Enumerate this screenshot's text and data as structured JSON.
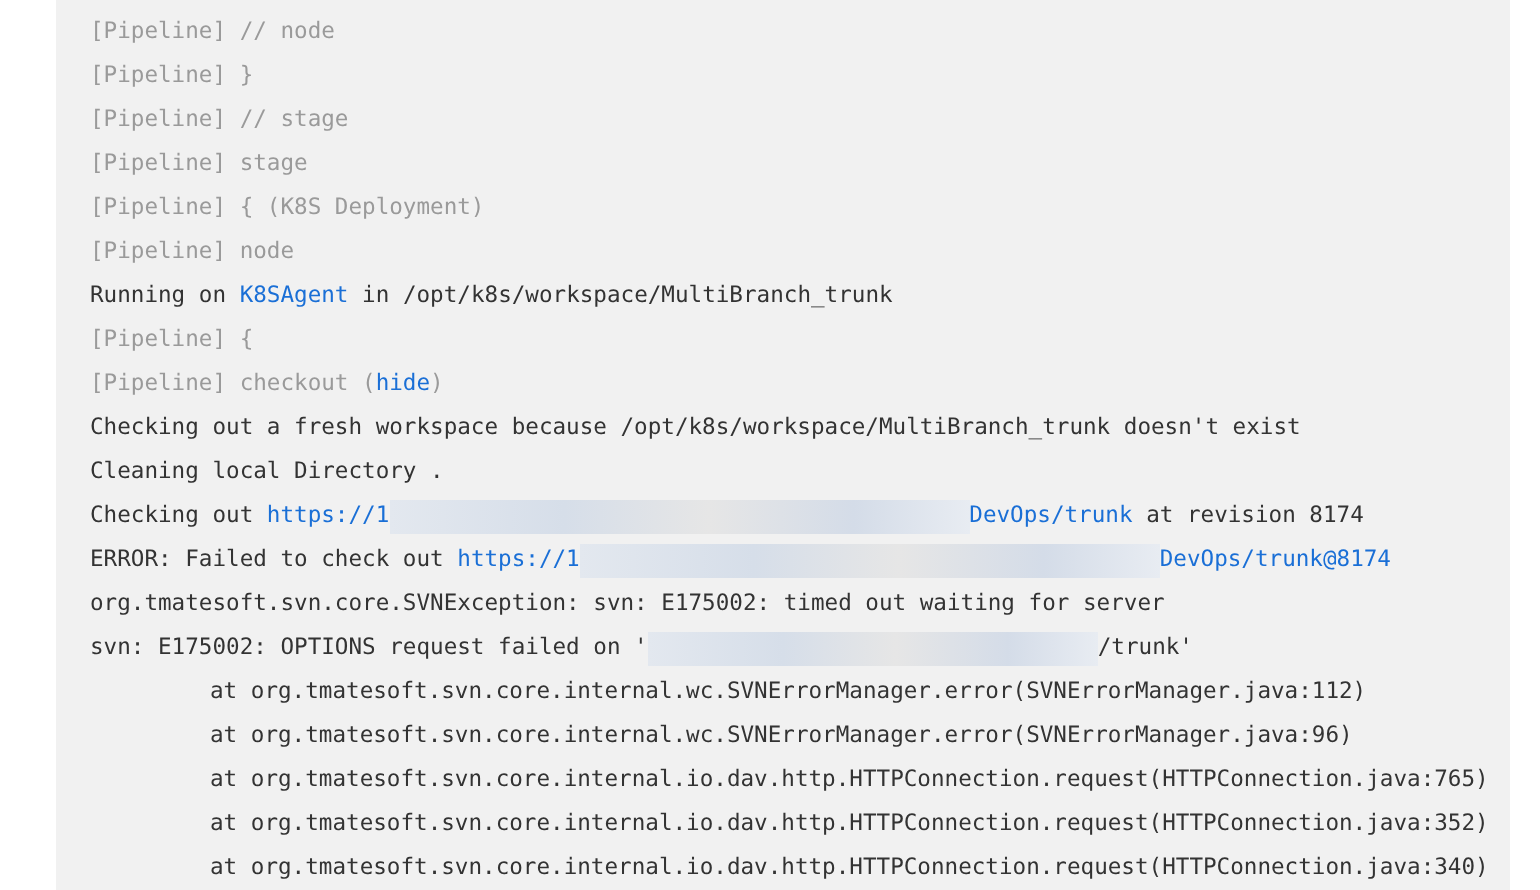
{
  "console_lines": [
    {
      "segments": [
        {
          "kind": "gray",
          "text": "[Pipeline] // node"
        }
      ]
    },
    {
      "segments": [
        {
          "kind": "gray",
          "text": "[Pipeline] }"
        }
      ]
    },
    {
      "segments": [
        {
          "kind": "gray",
          "text": "[Pipeline] // stage"
        }
      ]
    },
    {
      "segments": [
        {
          "kind": "gray",
          "text": "[Pipeline] stage"
        }
      ]
    },
    {
      "segments": [
        {
          "kind": "gray",
          "text": "[Pipeline] { (K8S Deployment)"
        }
      ]
    },
    {
      "segments": [
        {
          "kind": "gray",
          "text": "[Pipeline] node"
        }
      ]
    },
    {
      "segments": [
        {
          "kind": "text",
          "text": "Running on "
        },
        {
          "kind": "link",
          "text": "K8SAgent"
        },
        {
          "kind": "text",
          "text": " in /opt/k8s/workspace/MultiBranch_trunk"
        }
      ]
    },
    {
      "segments": [
        {
          "kind": "gray",
          "text": "[Pipeline] {"
        }
      ]
    },
    {
      "segments": [
        {
          "kind": "gray",
          "text": "[Pipeline] checkout ("
        },
        {
          "kind": "link",
          "text": "hide"
        },
        {
          "kind": "gray",
          "text": ")"
        }
      ]
    },
    {
      "segments": [
        {
          "kind": "text",
          "text": "Checking out a fresh workspace because /opt/k8s/workspace/MultiBranch_trunk doesn't exist"
        }
      ]
    },
    {
      "segments": [
        {
          "kind": "text",
          "text": "Cleaning local Directory ."
        }
      ]
    },
    {
      "segments": [
        {
          "kind": "text",
          "text": "Checking out "
        },
        {
          "kind": "link",
          "text": "https://1"
        },
        {
          "kind": "redacted"
        },
        {
          "kind": "link",
          "text": "DevOps/trunk"
        },
        {
          "kind": "text",
          "text": " at revision 8174"
        }
      ]
    },
    {
      "segments": [
        {
          "kind": "text",
          "text": "ERROR: Failed to check out "
        },
        {
          "kind": "link",
          "text": "https://1"
        },
        {
          "kind": "redacted"
        },
        {
          "kind": "link",
          "text": "DevOps/trunk@8174"
        }
      ]
    },
    {
      "segments": [
        {
          "kind": "text",
          "text": "org.tmatesoft.svn.core.SVNException: svn: E175002: timed out waiting for server"
        }
      ]
    },
    {
      "segments": [
        {
          "kind": "text",
          "text": "svn: E175002: OPTIONS request failed on '"
        },
        {
          "kind": "redacted"
        },
        {
          "kind": "text",
          "text": "/trunk'"
        }
      ]
    },
    {
      "indented": true,
      "segments": [
        {
          "kind": "text",
          "text": "at org.tmatesoft.svn.core.internal.wc.SVNErrorManager.error(SVNErrorManager.java:112)"
        }
      ]
    },
    {
      "indented": true,
      "segments": [
        {
          "kind": "text",
          "text": "at org.tmatesoft.svn.core.internal.wc.SVNErrorManager.error(SVNErrorManager.java:96)"
        }
      ]
    },
    {
      "indented": true,
      "segments": [
        {
          "kind": "text",
          "text": "at org.tmatesoft.svn.core.internal.io.dav.http.HTTPConnection.request(HTTPConnection.java:765)"
        }
      ]
    },
    {
      "indented": true,
      "segments": [
        {
          "kind": "text",
          "text": "at org.tmatesoft.svn.core.internal.io.dav.http.HTTPConnection.request(HTTPConnection.java:352)"
        }
      ]
    },
    {
      "indented": true,
      "segments": [
        {
          "kind": "text",
          "text": "at org.tmatesoft.svn.core.internal.io.dav.http.HTTPConnection.request(HTTPConnection.java:340)"
        }
      ]
    }
  ]
}
